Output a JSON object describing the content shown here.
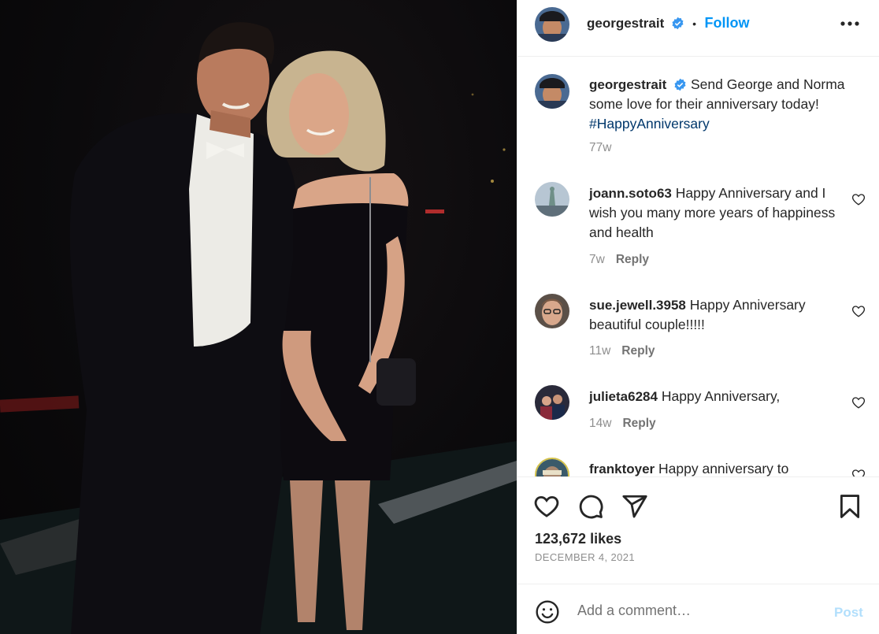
{
  "post": {
    "username": "georgestrait",
    "follow_label": "Follow",
    "separator": "•",
    "more_label": "•••",
    "likes": "123,672 likes",
    "date": "DECEMBER 4, 2021"
  },
  "caption": {
    "username": "georgestrait",
    "text": "Send George and Norma some love for their anniversary today!",
    "hashtag": "#HappyAnniversary",
    "age": "77w"
  },
  "comments": [
    {
      "username": "joann.soto63",
      "text": "Happy Anniversary and I wish you many more years of happiness and health",
      "age": "7w",
      "reply": "Reply"
    },
    {
      "username": "sue.jewell.3958",
      "text": "Happy Anniversary beautiful couple!!!!!",
      "age": "11w",
      "reply": "Reply"
    },
    {
      "username": "julieta6284",
      "text": "Happy Anniversary,",
      "age": "14w",
      "reply": "Reply"
    },
    {
      "username": "franktoyer",
      "text": "Happy anniversary to",
      "age": "",
      "reply": ""
    }
  ],
  "add_comment": {
    "placeholder": "Add a comment…",
    "post_label": "Post"
  },
  "colors": {
    "accent": "#0095f6",
    "verified": "#3897f0",
    "hashtag": "#00376b",
    "muted": "#8e8e8e",
    "post_disabled": "#b2dffc"
  },
  "icons": [
    "verified-badge-icon",
    "more-options-icon",
    "heart-icon",
    "comment-icon",
    "share-icon",
    "bookmark-icon",
    "emoji-icon"
  ]
}
